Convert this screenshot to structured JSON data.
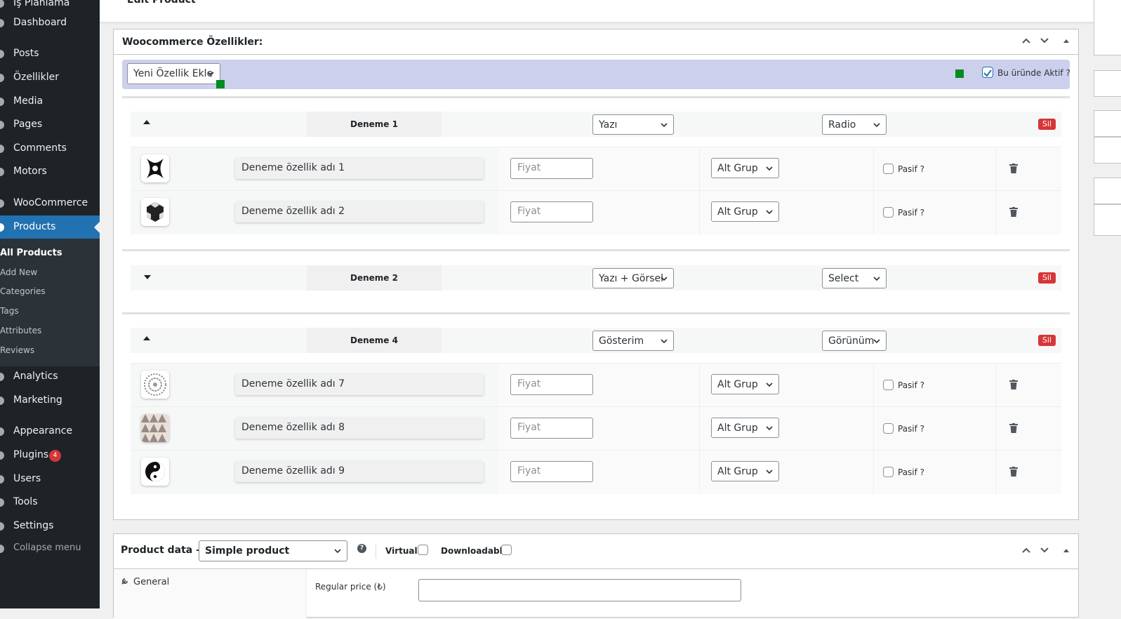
{
  "sidebar": {
    "items": [
      {
        "label": "İş Planlama",
        "icon": "calendar-icon"
      },
      {
        "label": "Dashboard",
        "icon": "dashboard-icon"
      },
      {
        "label": "Posts",
        "icon": "pin-icon"
      },
      {
        "label": "Özellikler",
        "icon": "pin-icon"
      },
      {
        "label": "Media",
        "icon": "media-icon"
      },
      {
        "label": "Pages",
        "icon": "pages-icon"
      },
      {
        "label": "Comments",
        "icon": "comment-icon"
      },
      {
        "label": "Motors",
        "icon": "pin-icon"
      },
      {
        "label": "WooCommerce",
        "icon": "woocommerce-icon"
      },
      {
        "label": "Products",
        "icon": "products-icon"
      },
      {
        "label": "Analytics",
        "icon": "analytics-icon"
      },
      {
        "label": "Marketing",
        "icon": "megaphone-icon"
      },
      {
        "label": "Appearance",
        "icon": "brush-icon"
      },
      {
        "label": "Plugins",
        "icon": "plugin-icon",
        "badge": "4"
      },
      {
        "label": "Users",
        "icon": "users-icon"
      },
      {
        "label": "Tools",
        "icon": "wrench-icon"
      },
      {
        "label": "Settings",
        "icon": "settings-icon"
      },
      {
        "label": "Collapse menu",
        "icon": "collapse-icon"
      }
    ],
    "submenu": [
      "All Products",
      "Add New",
      "Categories",
      "Tags",
      "Attributes",
      "Reviews"
    ]
  },
  "page": {
    "title": "Edit Product"
  },
  "features_box": {
    "title": "Woocommerce Özellikler:",
    "add_select": "Yeni Özellik Ekle",
    "active_label": "Bu üründe Aktif ?",
    "groups": [
      {
        "name": "Deneme 1",
        "type": "Yazı",
        "display": "Radio",
        "delete": "Sil",
        "rows": [
          {
            "name": "Deneme özellik adı 1",
            "price_placeholder": "Fiyat",
            "subgroup": "Alt Grup",
            "passive": "Pasif ?"
          },
          {
            "name": "Deneme özellik adı 2",
            "price_placeholder": "Fiyat",
            "subgroup": "Alt Grup",
            "passive": "Pasif ?"
          }
        ]
      },
      {
        "name": "Deneme 2",
        "type": "Yazı + Görsel",
        "display": "Select",
        "delete": "Sil",
        "rows": []
      },
      {
        "name": "Deneme 4",
        "type": "Gösterim",
        "display": "Görünüm",
        "delete": "Sil",
        "rows": [
          {
            "name": "Deneme özellik adı 7",
            "price_placeholder": "Fiyat",
            "subgroup": "Alt Grup",
            "passive": "Pasif ?"
          },
          {
            "name": "Deneme özellik adı 8",
            "price_placeholder": "Fiyat",
            "subgroup": "Alt Grup",
            "passive": "Pasif ?"
          },
          {
            "name": "Deneme özellik adı 9",
            "price_placeholder": "Fiyat",
            "subgroup": "Alt Grup",
            "passive": "Pasif ?"
          }
        ]
      }
    ]
  },
  "product_data": {
    "title": "Product data —",
    "type_select": "Simple product",
    "virtual_label": "Virtual:",
    "downloadable_label": "Downloadable:",
    "tab_general": "General",
    "regular_price_label": "Regular price (₺)"
  },
  "colors": {
    "sidebar": "#1d2327",
    "accent": "#2271b1",
    "delete": "#d63638",
    "bar": "#ccd0ec",
    "green": "#008a20"
  }
}
